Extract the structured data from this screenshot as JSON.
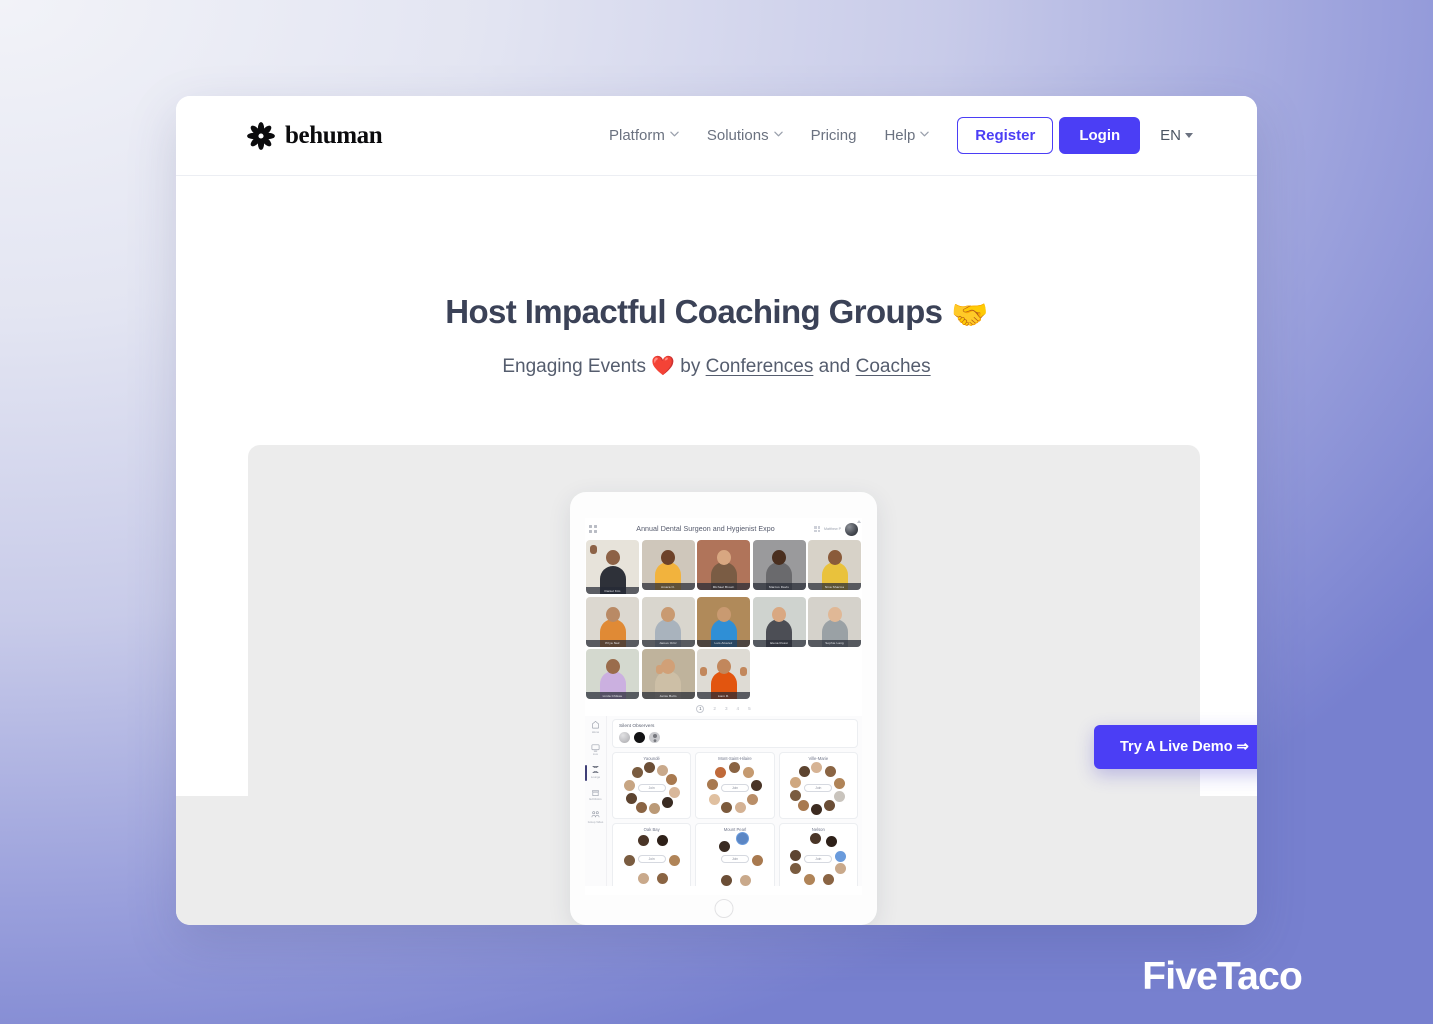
{
  "header": {
    "logo_text": "behuman",
    "logo_icon": "flower-asterisk-icon",
    "nav": [
      {
        "label": "Platform",
        "has_caret": true
      },
      {
        "label": "Solutions",
        "has_caret": true
      },
      {
        "label": "Pricing",
        "has_caret": false
      },
      {
        "label": "Help",
        "has_caret": true
      }
    ],
    "register_label": "Register",
    "login_label": "Login",
    "language_label": "EN"
  },
  "hero": {
    "title": "Host Impactful Coaching Groups",
    "title_emoji": "🤝",
    "subtitle_prefix": "Engaging Events",
    "subtitle_emoji": "❤️",
    "subtitle_by": "by",
    "link_one": "Conferences",
    "subtitle_and": "and",
    "link_two": "Coaches"
  },
  "cta": {
    "label": "Try A Live Demo ⇒"
  },
  "product": {
    "meeting_title": "Annual Dental Surgeon and Hygienist Expo",
    "host_name": "Matthew P",
    "pagination": [
      "1",
      "2",
      "3",
      "4",
      "5"
    ],
    "active_page": "1",
    "participants": [
      {
        "name": "Daniel Kim",
        "shirt": "#2e3139",
        "skin": "#8d6246",
        "bg": "#e7e3da",
        "hand": true
      },
      {
        "name": "Amara O.",
        "shirt": "#f2b33d",
        "skin": "#6d4229",
        "bg": "#cfc7bb",
        "hand": false
      },
      {
        "name": "Michael Brown",
        "shirt": "#7a5c44",
        "skin": "#d8a781",
        "bg": "#b0745a",
        "hand": false
      },
      {
        "name": "Marcus Davis",
        "shirt": "#6a6a6d",
        "skin": "#4a2f1f",
        "bg": "#9a9a9c",
        "hand": false
      },
      {
        "name": "Nina Sharma",
        "shirt": "#e9c23c",
        "skin": "#8a5b3a",
        "bg": "#d7d2c8",
        "hand": false
      },
      {
        "name": "Priya Nair",
        "shirt": "#e08a35",
        "skin": "#b98a65",
        "bg": "#dcd8d0",
        "hand": false
      },
      {
        "name": "James Ortiz",
        "shirt": "#a9b3bd",
        "skin": "#c99a71",
        "bg": "#d9d6ce",
        "hand": false
      },
      {
        "name": "Luis Alvarez",
        "shirt": "#2f8fd6",
        "skin": "#c99a71",
        "bg": "#b08a5a",
        "hand": false
      },
      {
        "name": "Elena Rossi",
        "shirt": "#4c4e55",
        "skin": "#d9a882",
        "bg": "#cfd3cf",
        "hand": false
      },
      {
        "name": "Sophie Lang",
        "shirt": "#9aa1a5",
        "skin": "#e0b896",
        "bg": "#d5d2cb",
        "hand": false
      },
      {
        "name": "Linda Chikwe",
        "shirt": "#cbb0e0",
        "skin": "#9a6c4c",
        "bg": "#d4d9cf",
        "hand": false
      },
      {
        "name": "Jamie Bello",
        "shirt": "#cdbfa6",
        "skin": "#d1a077",
        "bg": "#bfb39c",
        "hand": true
      },
      {
        "name": "Liam R.",
        "shirt": "#e2550f",
        "skin": "#c2875c",
        "bg": "#dedbd4",
        "hand": true
      }
    ],
    "observers_title": "Silent Observers",
    "observers": [
      "observer-avatar-gray",
      "observer-avatar-dark",
      "observer-avatar-placeholder"
    ],
    "rooms": [
      {
        "name": "Yaoundé",
        "join_label": "Join",
        "seats": 10
      },
      {
        "name": "Mont-Saint-Hilaire",
        "join_label": "Join",
        "seats": 9
      },
      {
        "name": "Ville-Marie",
        "join_label": "Join",
        "seats": 10
      },
      {
        "name": "Oak Bay",
        "join_label": "Join",
        "seats": 10
      },
      {
        "name": "Mount Pearl",
        "join_label": "Join",
        "seats": 9
      },
      {
        "name": "Nelson",
        "join_label": "Join",
        "seats": 10
      }
    ],
    "sidebar": [
      {
        "label": "Home",
        "icon": "home-icon",
        "active": false
      },
      {
        "label": "Live",
        "icon": "screen-icon",
        "active": false
      },
      {
        "label": "Lounge",
        "icon": "lounge-icon",
        "active": true
      },
      {
        "label": "Exhibitors",
        "icon": "booth-icon",
        "active": false
      },
      {
        "label": "Group Video",
        "icon": "group-video-icon",
        "active": false
      }
    ]
  },
  "watermark": {
    "text": "FiveTaco"
  },
  "colors": {
    "accent": "#4b3ef5",
    "heading": "#3b4257",
    "muted": "#6b7280",
    "page_bg_light": "#eef0f7",
    "page_bg_dark": "#6f78cb",
    "showcase_bg": "#ececec"
  }
}
